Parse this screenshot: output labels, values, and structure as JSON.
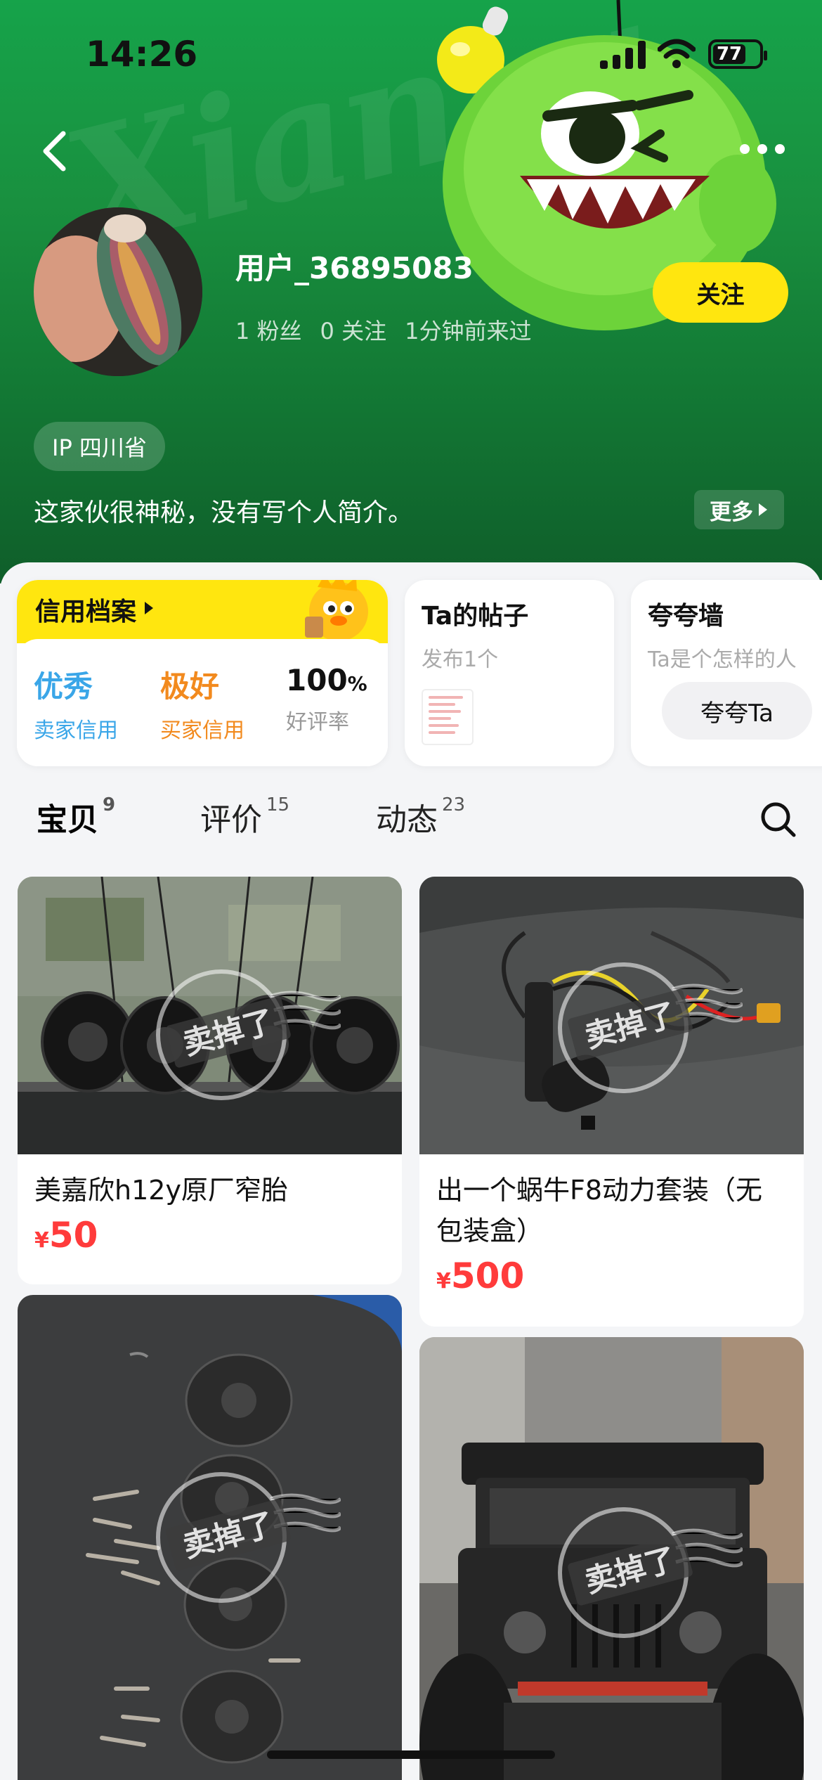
{
  "status_bar": {
    "time": "14:26",
    "battery": "77"
  },
  "profile": {
    "username": "用户_36895083",
    "followers": "1 粉丝",
    "following": "0 关注",
    "last_seen": "1分钟前来过",
    "follow_label": "关注",
    "ip_location": "IP 四川省",
    "bio": "这家伙很神秘，没有写个人简介。",
    "more_label": "更多"
  },
  "credit_card": {
    "title": "信用档案",
    "seller_value": "优秀",
    "seller_label": "卖家信用",
    "buyer_value": "极好",
    "buyer_label": "买家信用",
    "rating_value": "100",
    "rating_unit": "%",
    "rating_label": "好评率"
  },
  "posts_card": {
    "title": "Ta的帖子",
    "subtitle": "发布1个"
  },
  "praise_card": {
    "title": "夸夸墙",
    "subtitle": "Ta是个怎样的人",
    "button": "夸夸Ta"
  },
  "tabs": [
    {
      "label": "宝贝",
      "count": "9"
    },
    {
      "label": "评价",
      "count": "15"
    },
    {
      "label": "动态",
      "count": "23"
    }
  ],
  "products": [
    {
      "title": "美嘉欣h12y原厂窄胎",
      "currency": "¥",
      "price": "50",
      "sold": "卖掉了"
    },
    {
      "title": "出一个蜗牛F8动力套装（无包装盒）",
      "currency": "¥",
      "price": "500",
      "sold": "卖掉了"
    },
    {
      "title": "",
      "currency": "",
      "price": "",
      "sold": "卖掉了"
    },
    {
      "title": "",
      "currency": "",
      "price": "",
      "sold": "卖掉了"
    }
  ],
  "colors": {
    "header_green": "#16a34a",
    "accent_yellow": "#ffe60f",
    "price_red": "#ff3b3b",
    "seller_blue": "#3aa6e8",
    "buyer_orange": "#f28a1e"
  }
}
